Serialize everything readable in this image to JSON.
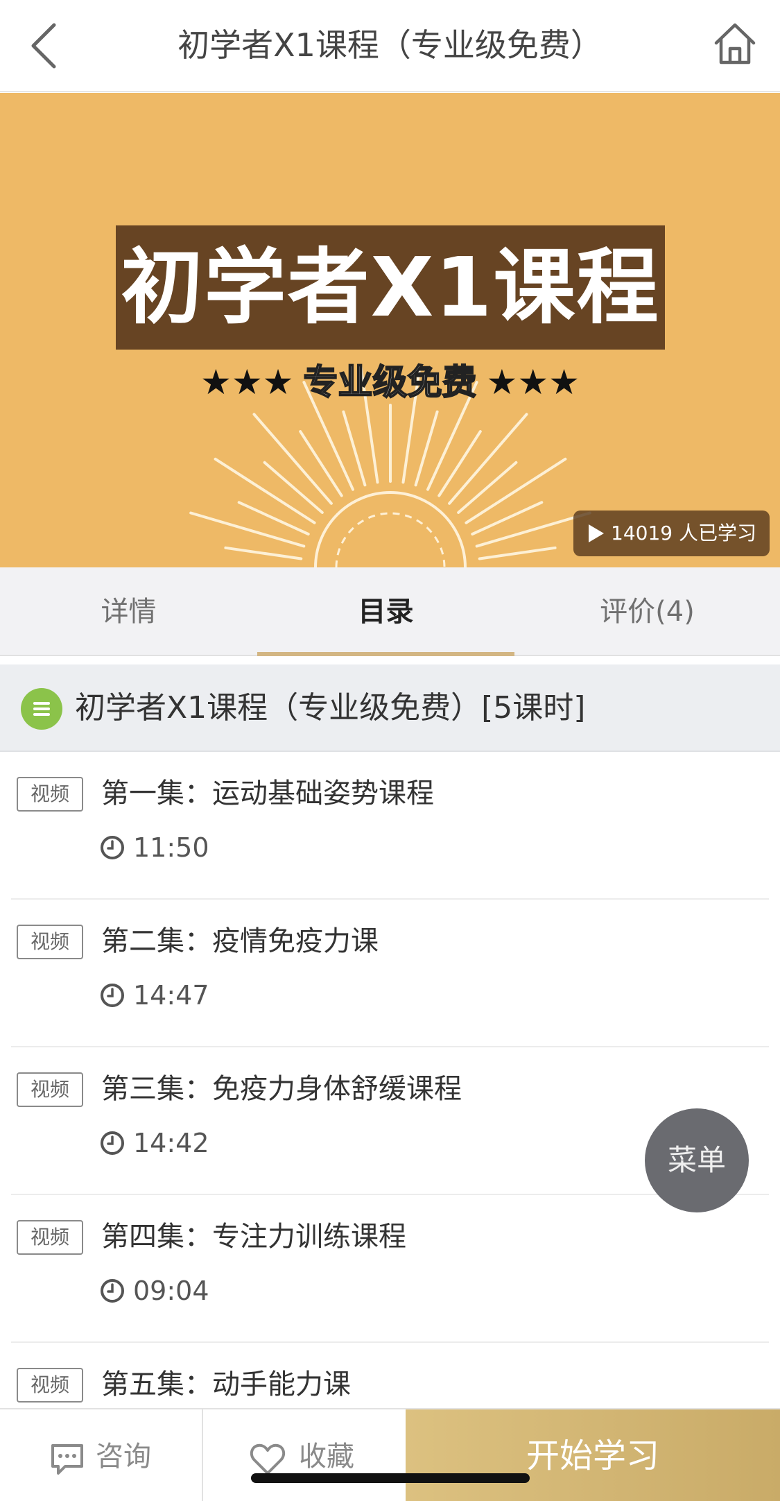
{
  "nav": {
    "title": "初学者X1课程（专业级免费）",
    "back_icon": "chevron-left-icon",
    "home_icon": "home-icon"
  },
  "banner": {
    "title": "初学者X1课程",
    "stars_left": "★★★",
    "subtitle": "专业级免费",
    "stars_right": "★★★",
    "learners": "14019 人已学习",
    "colors": {
      "background": "#eeb966",
      "box": "#674423"
    }
  },
  "tabs": [
    {
      "label": "详情",
      "active": false
    },
    {
      "label": "目录",
      "active": true
    },
    {
      "label": "评价(4)",
      "active": false
    }
  ],
  "section": {
    "title": "初学者X1课程（专业级免费）[5课时]",
    "icon": "list-icon",
    "icon_color": "#8bc34a"
  },
  "lessons": [
    {
      "badge": "视频",
      "title": "第一集：运动基础姿势课程",
      "duration": "11:50"
    },
    {
      "badge": "视频",
      "title": "第二集：疫情免疫力课",
      "duration": "14:47"
    },
    {
      "badge": "视频",
      "title": "第三集：免疫力身体舒缓课程",
      "duration": "14:42"
    },
    {
      "badge": "视频",
      "title": "第四集：专注力训练课程",
      "duration": "09:04"
    },
    {
      "badge": "视频",
      "title": "第五集：动手能力课"
    }
  ],
  "fab": {
    "label": "菜单"
  },
  "bottom_bar": {
    "consult_label": "咨询",
    "favorite_label": "收藏",
    "start_label": "开始学习",
    "accent": "#d3b683"
  }
}
